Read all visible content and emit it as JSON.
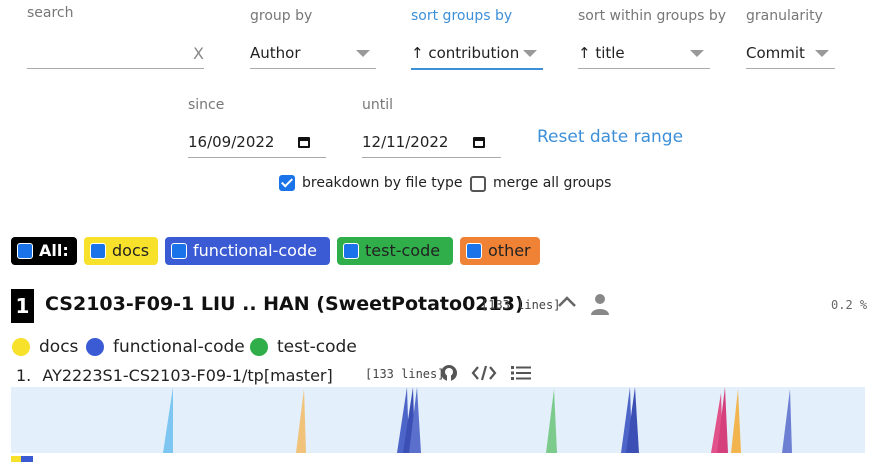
{
  "filters": {
    "search": {
      "label": "search",
      "value": "",
      "clear": "X"
    },
    "group_by": {
      "label": "group by",
      "value": "Author"
    },
    "sort_groups_by": {
      "label": "sort groups by",
      "value": "↑ contribution"
    },
    "sort_within_groups_by": {
      "label": "sort within groups by",
      "value": "↑ title"
    },
    "granularity": {
      "label": "granularity",
      "value": "Commit"
    },
    "since": {
      "label": "since",
      "value": "16/09/2022"
    },
    "until": {
      "label": "until",
      "value": "12/11/2022"
    },
    "reset_date_range": "Reset date range",
    "breakdown_by_file_type": {
      "label": "breakdown by file type",
      "checked": true
    },
    "merge_all_groups": {
      "label": "merge all groups",
      "checked": false
    }
  },
  "file_types": [
    {
      "label": "All:",
      "checked": true,
      "color": "#000000"
    },
    {
      "label": "docs",
      "checked": true,
      "color": "#f7e12b"
    },
    {
      "label": "functional-code",
      "checked": true,
      "color": "#3b5bd4"
    },
    {
      "label": "test-code",
      "checked": true,
      "color": "#2fae49"
    },
    {
      "label": "other",
      "checked": true,
      "color": "#f08236"
    }
  ],
  "group": {
    "rank": "1",
    "title": "CS2103-F09-1 LIU .. HAN (SweetPotato0213)",
    "lines": "[133 lines]",
    "percent": "0.2 %",
    "legend": [
      {
        "label": "docs",
        "color": "#f7e12b"
      },
      {
        "label": "functional-code",
        "color": "#3b5bd4"
      },
      {
        "label": "test-code",
        "color": "#2fae49"
      }
    ],
    "repo": {
      "index": "1.",
      "name": "AY2223S1-CS2103-F09-1/tp[master]",
      "lines": "[133 lines]"
    }
  }
}
